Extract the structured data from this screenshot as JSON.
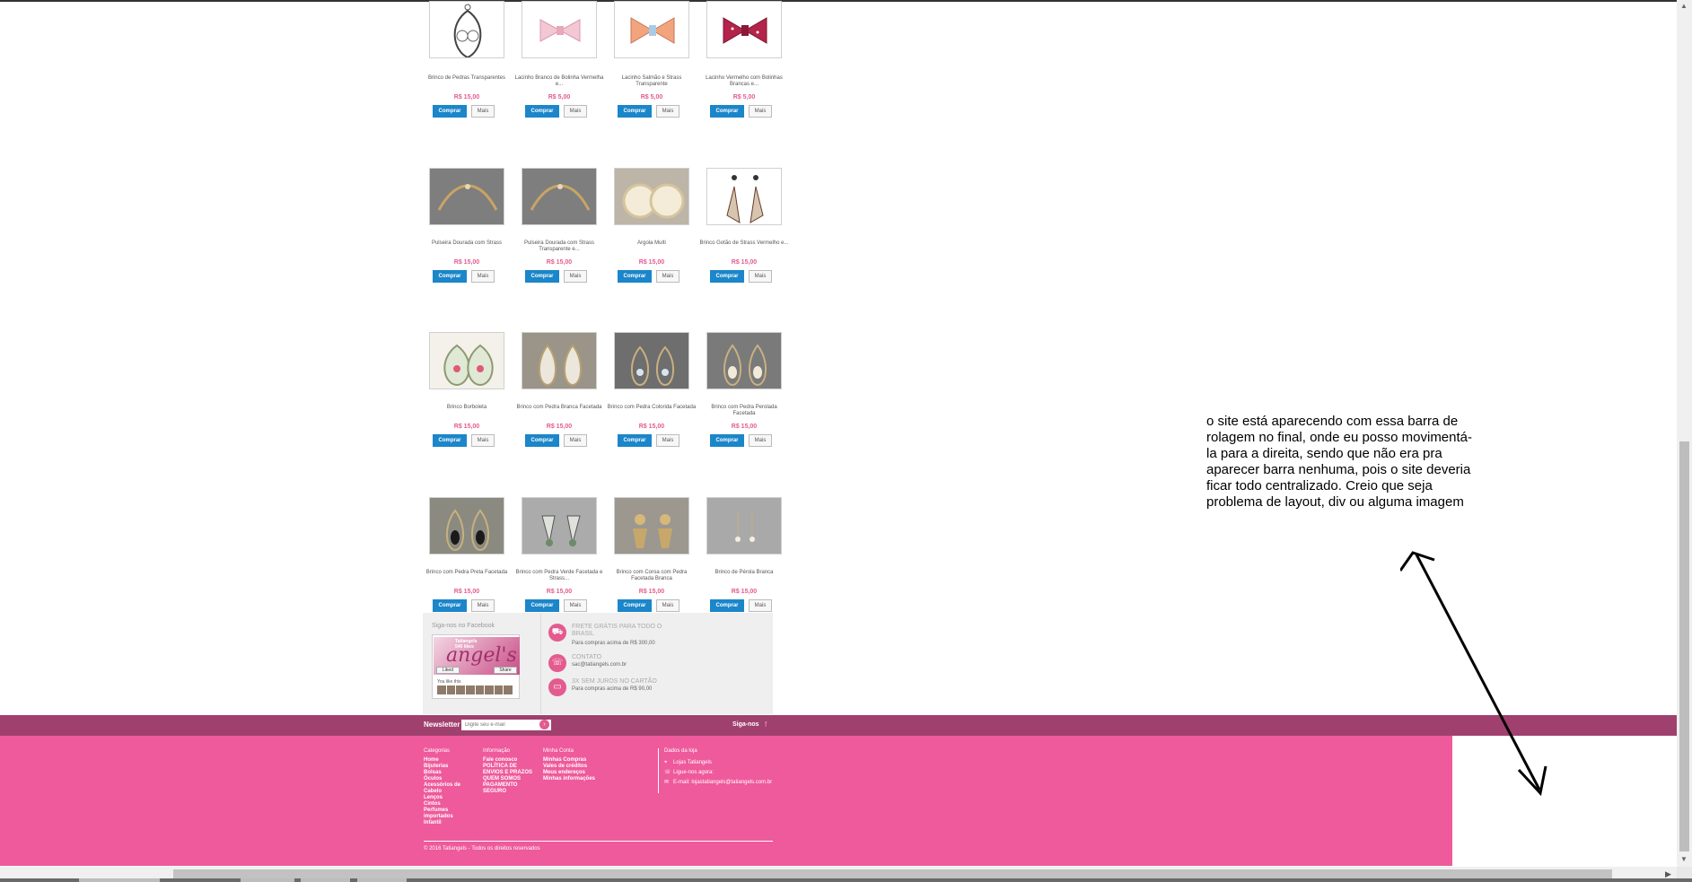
{
  "products": [
    {
      "name": "Brinco de Pedras Transparentes",
      "price": "R$ 15,00",
      "thumb": "earring-filigree"
    },
    {
      "name": "Lacinho Branco de Bolinha Vermelha e...",
      "price": "R$ 5,00",
      "thumb": "bow-white"
    },
    {
      "name": "Lacinho Salmão e Strass Transparente",
      "price": "R$ 5,00",
      "thumb": "bow-salmon"
    },
    {
      "name": "Lacinho Vermelho com Bolinhas Brancas e...",
      "price": "R$ 5,00",
      "thumb": "bow-red"
    },
    {
      "name": "Pulseira Dourada com Strass",
      "price": "R$ 15,00",
      "thumb": "bracelet-gold"
    },
    {
      "name": "Pulseira Dourada com Strass Transparente e...",
      "price": "R$ 15,00",
      "thumb": "bracelet-gold"
    },
    {
      "name": "Argola Multi",
      "price": "R$ 15,00",
      "thumb": "hoop-earring"
    },
    {
      "name": "Brinco Gotão de Strass Vermelho e...",
      "price": "R$ 15,00",
      "thumb": "earring-drop"
    },
    {
      "name": "Brinco Borboleta",
      "price": "R$ 15,00",
      "thumb": "earring-butterfly"
    },
    {
      "name": "Brinco com Pedra Branca Facetada",
      "price": "R$ 15,00",
      "thumb": "earring-white"
    },
    {
      "name": "Brinco com Pedra Colorida Facetada",
      "price": "R$ 15,00",
      "thumb": "earring-color"
    },
    {
      "name": "Brinco com Pedra Perolada Facetada",
      "price": "R$ 15,00",
      "thumb": "earring-pearl"
    },
    {
      "name": "Brinco com Pedra Preta Facetada",
      "price": "R$ 15,00",
      "thumb": "earring-black"
    },
    {
      "name": "Brinco com Pedra Verde Facetada e Strass...",
      "price": "R$ 15,00",
      "thumb": "earring-green"
    },
    {
      "name": "Brinco com Coroa com Pedra Facetada Branca",
      "price": "R$ 15,00",
      "thumb": "earring-crown"
    },
    {
      "name": "Brinco de Pérola Branca",
      "price": "R$ 15,00",
      "thumb": "earring-pearl-small"
    }
  ],
  "buttons": {
    "buy": "Comprar",
    "more": "Mais"
  },
  "facebook": {
    "title": "Siga-nos no Facebook",
    "page_name": "Tatiangels",
    "likes": "540 likes",
    "banner_text": "angel's",
    "like_button": "Liked",
    "share_button": "Share",
    "you_like": "You like this"
  },
  "info": [
    {
      "title": "FRETE GRÁTIS PARA TODO O BRASIL",
      "subtitle": "Para compras acima de R$ 300,00",
      "icon": "truck-icon"
    },
    {
      "title": "CONTATO",
      "subtitle": "sac@tatiangels.com.br",
      "icon": "phone-icon"
    },
    {
      "title": "3X SEM JUROS NO CARTÃO",
      "subtitle": "Para compras acima de R$ 90,00",
      "icon": "card-icon"
    }
  ],
  "newsletter": {
    "label": "Newsletter",
    "placeholder": "Digite seu e-mail",
    "follow": "Siga-nos",
    "facebook": "f"
  },
  "footer": {
    "categories": {
      "title": "Categorias",
      "items": [
        "Home",
        "Bijuterias",
        "Bolsas",
        "Óculos",
        "Acessórios de Cabelo",
        "Lenços",
        "Cintos",
        "Perfumes importados",
        "Infantil"
      ]
    },
    "information": {
      "title": "Informação",
      "items": [
        "Fale conosco",
        "POLÍTICA DE ENVIOS E PRAZOS",
        "QUEM SOMOS",
        "PAGAMENTO SEGURO"
      ]
    },
    "account": {
      "title": "Minha Conta",
      "items": [
        "Minhas Compras",
        "Vales de créditos",
        "Meus endereços",
        "Minhas informações"
      ]
    },
    "shop": {
      "title": "Dados da loja",
      "rows": [
        "Lojas Tatiangels",
        "Ligue-nos agora:",
        "E-mail: lojastatiangels@tatiangels.com.br"
      ]
    },
    "copyright": "© 2016 Tatiangels - Todos os direitos reservados"
  },
  "annotation": "o site está aparecendo com essa barra de rolagem no final, onde eu posso movimentá-la para a direita, sendo que não era pra aparecer barra nenhuma, pois o site deveria ficar todo centralizado. Creio que seja problema de layout, div ou alguma imagem",
  "colors": {
    "accent_pink": "#ee5a9b",
    "bar_plum": "#a0406e",
    "buy_blue": "#1b86c9",
    "price_pink": "#e35b8f"
  }
}
